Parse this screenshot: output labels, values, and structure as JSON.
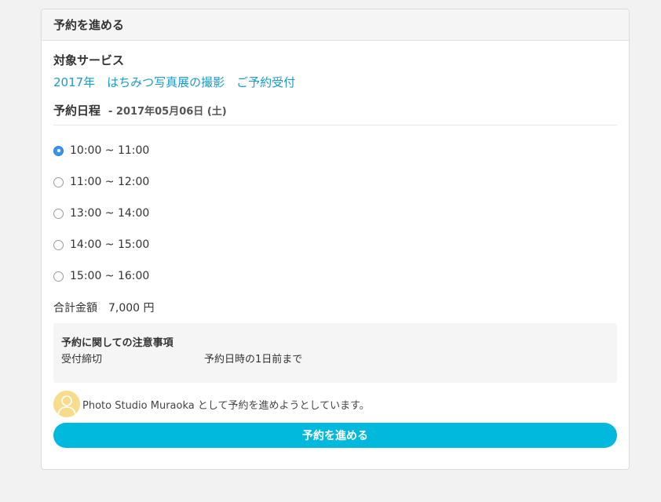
{
  "panel": {
    "title": "予約を進める"
  },
  "service": {
    "label": "対象サービス",
    "name": "2017年　はちみつ写真展の撮影　ご予約受付"
  },
  "schedule": {
    "label": "予約日程",
    "date": "- 2017年05月06日 (土)",
    "slots": [
      {
        "label": "10:00 ~ 11:00",
        "selected": true
      },
      {
        "label": "11:00 ~ 12:00",
        "selected": false
      },
      {
        "label": "13:00 ~ 14:00",
        "selected": false
      },
      {
        "label": "14:00 ~ 15:00",
        "selected": false
      },
      {
        "label": "15:00 ~ 16:00",
        "selected": false
      }
    ]
  },
  "total": {
    "label": "合計金額",
    "amount": "7,000 円"
  },
  "notes": {
    "title": "予約に関しての注意事項",
    "deadline_key": "受付締切",
    "deadline_value": "予約日時の1日前まで"
  },
  "owner": {
    "text": "Photo Studio Muraoka として予約を進めようとしています。"
  },
  "submit": {
    "label": "予約を進める"
  },
  "colors": {
    "accent": "#00b9dd",
    "link": "#1a9bc9",
    "radio_selected": "#3b93f0",
    "avatar": "#f7dc8c"
  },
  "icons": {
    "avatar": "user-avatar-icon",
    "radio": "radio-button-icon"
  }
}
